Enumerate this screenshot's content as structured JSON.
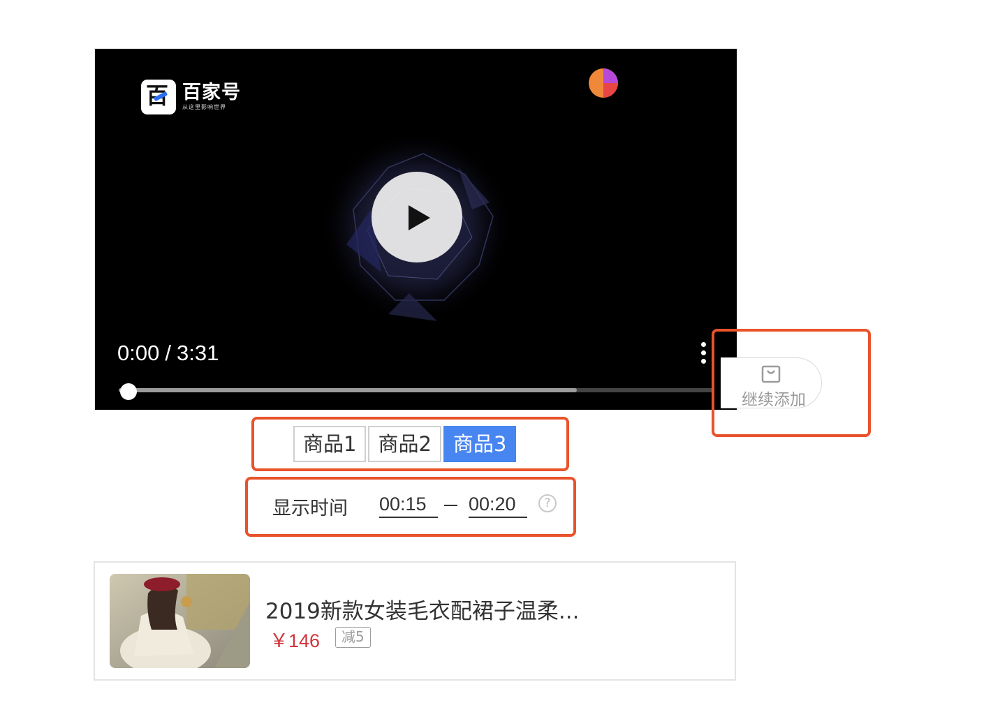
{
  "player": {
    "logo_title": "百家号",
    "logo_subtitle": "从这里影响世界",
    "current_time": "0:00",
    "separator": "/",
    "duration": "3:31",
    "progress_fraction": 0,
    "buffered_fraction": 0.77
  },
  "add_button": {
    "label": "继续添加",
    "icon": "shopping-bag-icon"
  },
  "tabs": [
    {
      "label": "商品1",
      "active": false
    },
    {
      "label": "商品2",
      "active": false
    },
    {
      "label": "商品3",
      "active": true
    }
  ],
  "display_time": {
    "label": "显示时间",
    "start": "00:15",
    "end": "00:20",
    "help_icon": "question-circle-icon"
  },
  "product": {
    "title": "2019新款女装毛衣配裙子温柔...",
    "price": "￥146",
    "coupon": "减5"
  },
  "colors": {
    "highlight": "#e8532b",
    "active_tab": "#4785f0",
    "price": "#d0343a"
  }
}
